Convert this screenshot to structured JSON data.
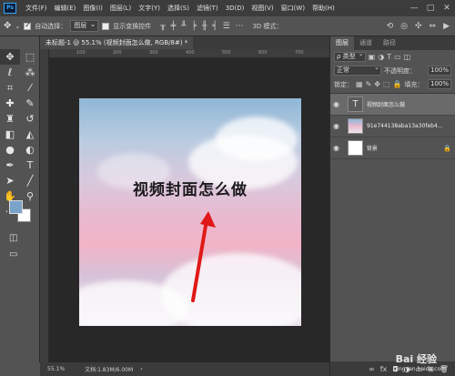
{
  "menubar": {
    "logo": "Ps",
    "items": [
      "文件(F)",
      "编辑(E)",
      "图像(I)",
      "图层(L)",
      "文字(Y)",
      "选择(S)",
      "滤镜(T)",
      "3D(D)",
      "视图(V)",
      "窗口(W)",
      "帮助(H)"
    ],
    "window_controls": [
      "—",
      "□",
      "✕"
    ]
  },
  "options_bar": {
    "auto_select_label": "自动选择：",
    "auto_select_value": "图层",
    "show_transform_label": "显示变换控件",
    "mode_3d": "3D 模式："
  },
  "document": {
    "tab_title": "未标题-1 @ 55.1% (视频封面怎么做, RGB/8#) *",
    "canvas_text": "视频封面怎么做",
    "ruler_ticks": [
      "100",
      "200",
      "300",
      "400",
      "500",
      "600",
      "700"
    ]
  },
  "status_bar": {
    "zoom": "55.1%",
    "doc_info": "文档:1.83M/6.00M"
  },
  "colors": {
    "foreground": "#7aa3c9",
    "background": "#ffffff",
    "accent": "#31a8ff"
  },
  "layers_panel": {
    "tabs": [
      "图层",
      "通道",
      "路径"
    ],
    "filter_label": "ρ 类型",
    "blend_mode": "正常",
    "opacity_label": "不透明度：",
    "opacity_value": "100%",
    "lock_label": "锁定：",
    "fill_label": "填充：",
    "fill_value": "100%",
    "layers": [
      {
        "name": "视频封面怎么做",
        "thumb": "T",
        "selected": true
      },
      {
        "name": "91e744138aba13a30feb4...",
        "thumb": "image",
        "selected": false
      },
      {
        "name": "背景",
        "thumb": "bg",
        "selected": false
      }
    ]
  },
  "watermark": {
    "brand": "Bai 经验",
    "url": "jingyan.baidu.com"
  }
}
